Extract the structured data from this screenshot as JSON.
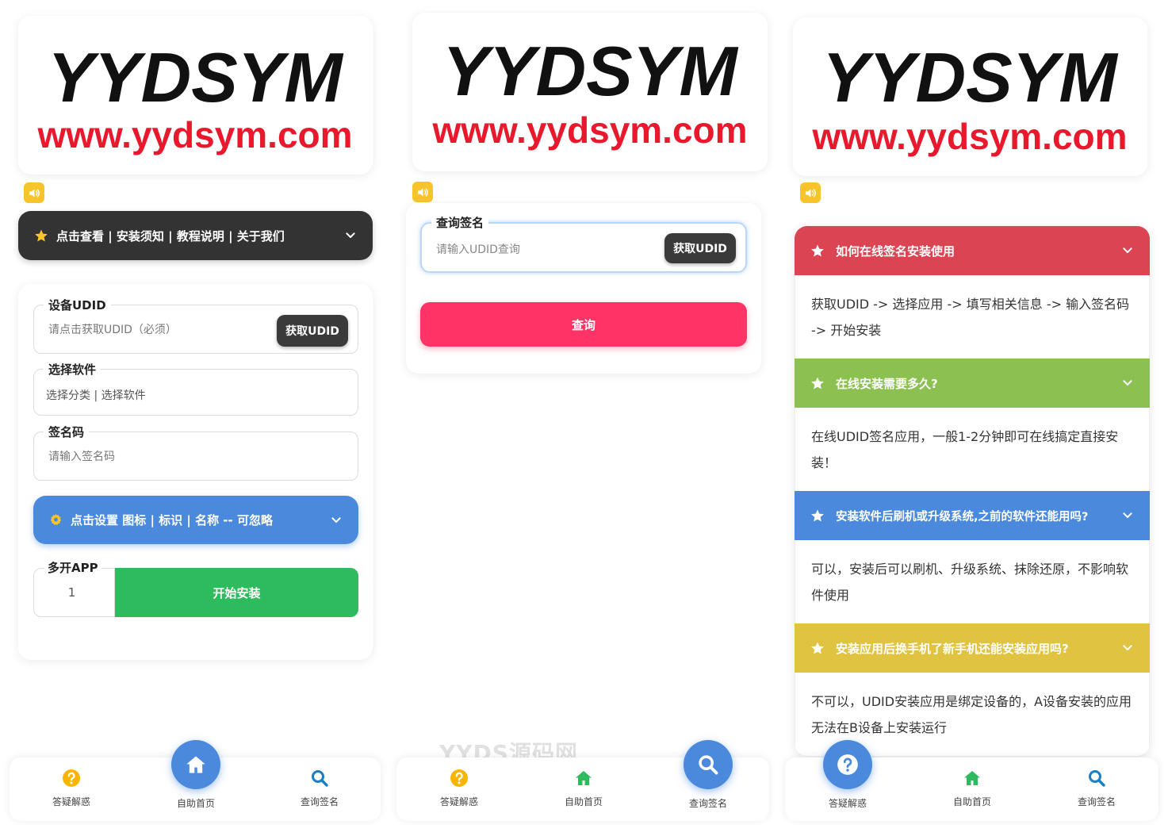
{
  "colors": {
    "dark": "#333333",
    "blue": "#4a89dc",
    "green": "#2dbb5d",
    "pink": "#ff3366",
    "red": "#db4453",
    "lime": "#8cc152",
    "yellow": "#e0c341",
    "logo_red": "#e8192c"
  },
  "logo": {
    "brand": "YYDSYM",
    "url": "www.yydsym.com"
  },
  "icons": {
    "speaker": "speaker-icon",
    "star": "star-icon",
    "gear": "gear-icon",
    "chevron": "chevron-down-icon"
  },
  "install": {
    "notice_bar": "点击查看 | 安装须知 | 教程说明 | 关于我们",
    "udid": {
      "label": "设备UDID",
      "placeholder": "请点击获取UDID（必须）",
      "button": "获取UDID"
    },
    "software": {
      "label": "选择软件",
      "placeholder": "选择分类 | 选择软件"
    },
    "code": {
      "label": "签名码",
      "placeholder": "请输入签名码"
    },
    "settings_bar": "点击设置 图标 | 标识 | 名称 -- 可忽略",
    "multi": {
      "label": "多开APP",
      "value": "1",
      "button": "开始安装"
    }
  },
  "query": {
    "label": "查询签名",
    "placeholder": "请输入UDID查询",
    "get_button": "获取UDID",
    "submit": "查询",
    "watermark": "YYDS源码网"
  },
  "faq": [
    {
      "q": "如何在线签名安装使用",
      "a": "获取UDID -> 选择应用 -> 填写相关信息 -> 输入签名码 -> 开始安装",
      "color": "#db4453"
    },
    {
      "q": "在线安装需要多久?",
      "a": "在线UDID签名应用，一般1-2分钟即可在线搞定直接安装！",
      "color": "#8cc152"
    },
    {
      "q": "安装软件后刷机或升级系统,之前的软件还能用吗?",
      "a": "可以，安装后可以刷机、升级系统、抹除还原，不影响软件使用",
      "color": "#4a89dc"
    },
    {
      "q": "安装应用后换手机了新手机还能安装应用吗?",
      "a": "不可以，UDID安装应用是绑定设备的，A设备安装的应用无法在B设备上安装运行",
      "color": "#e0c341"
    }
  ],
  "nav": {
    "help": "答疑解惑",
    "home": "自助首页",
    "query": "查询签名"
  }
}
